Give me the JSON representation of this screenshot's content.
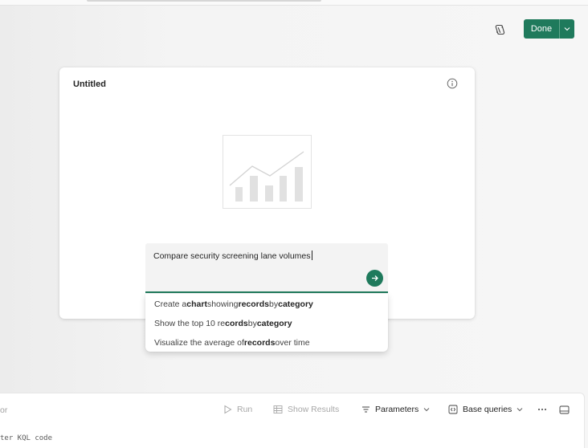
{
  "header": {
    "done_label": "Done"
  },
  "card": {
    "title": "Untitled"
  },
  "prompt": {
    "value": "Compare security screening lane volumes"
  },
  "suggestions": [
    {
      "parts": [
        [
          "Create a ",
          false
        ],
        [
          "chart",
          true
        ],
        [
          " showing ",
          false
        ],
        [
          "records",
          true
        ],
        [
          " by ",
          false
        ],
        [
          "category",
          true
        ]
      ]
    },
    {
      "parts": [
        [
          "Show the top 10 re",
          false
        ],
        [
          "cords",
          true
        ],
        [
          " by ",
          false
        ],
        [
          "category",
          true
        ]
      ]
    },
    {
      "parts": [
        [
          "Visualize the average of ",
          false
        ],
        [
          "records",
          true
        ],
        [
          " over time",
          false
        ]
      ]
    }
  ],
  "bottom": {
    "editor_label": "or",
    "kql_placeholder": "ter KQL code",
    "toolbar": {
      "run": "Run",
      "show_results": "Show Results",
      "parameters": "Parameters",
      "base_queries": "Base queries"
    }
  },
  "colors": {
    "accent": "#1f7a5c"
  }
}
